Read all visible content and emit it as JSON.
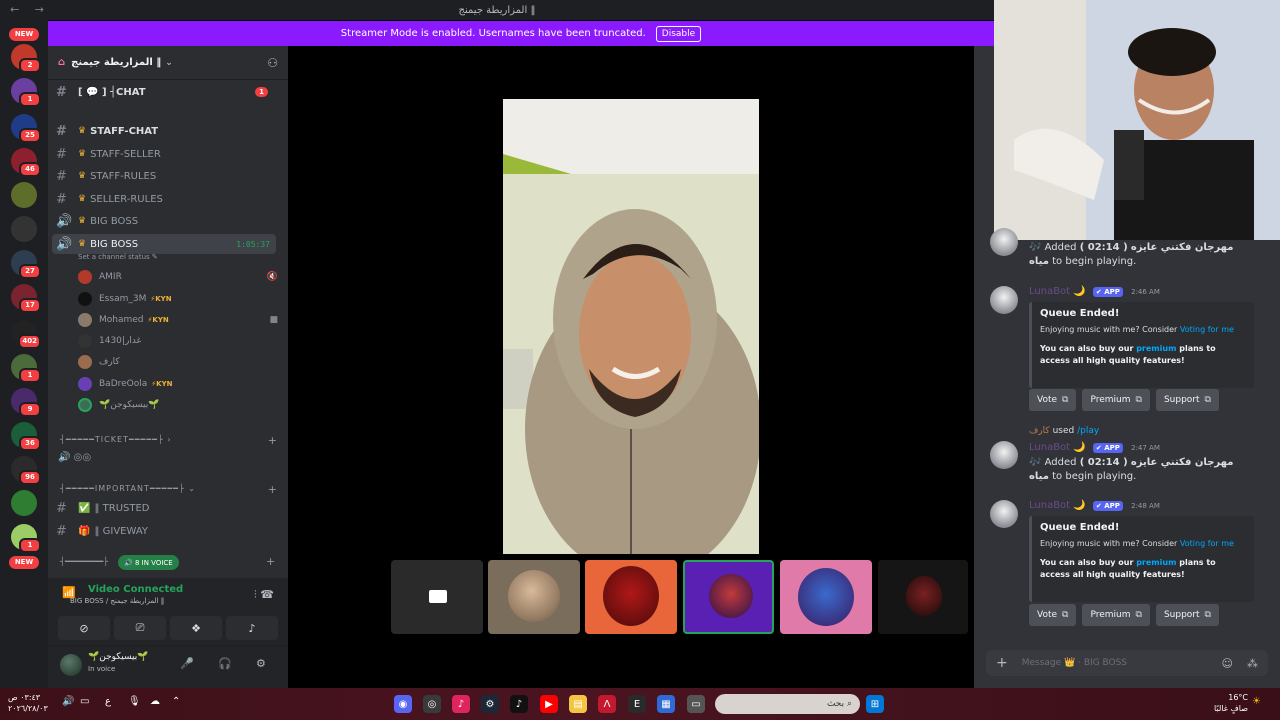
{
  "window": {
    "title": "المزاريطة جيمنج ‖"
  },
  "banner": {
    "text": "Streamer Mode is enabled. Usernames have been truncated.",
    "disable_label": "Disable"
  },
  "rail": {
    "new_top": "NEW",
    "new_bottom": "NEW",
    "badges": [
      "2",
      "1",
      "25",
      "46",
      "27",
      "17",
      "402",
      "1",
      "9",
      "36",
      "96",
      "1"
    ]
  },
  "server": {
    "name": "المزاريطة جيمنج ‖"
  },
  "channels": [
    {
      "name": "[ 💬 ] ┤CHAT",
      "unread": "1"
    },
    {
      "name": "STAFF-CHAT"
    },
    {
      "name": "STAFF-SELLER"
    },
    {
      "name": "STAFF-RULES"
    },
    {
      "name": "SELLER-RULES"
    },
    {
      "name": "BIG BOSS"
    },
    {
      "name": "BIG BOSS",
      "timer": "1:05:37"
    }
  ],
  "channel_status": "Set a channel status",
  "voice_users": [
    {
      "name": "AMIR",
      "tag": ""
    },
    {
      "name": "Essam_3M",
      "tag": "⚡KYN"
    },
    {
      "name": "Mohamed",
      "tag": "⚡KYN"
    },
    {
      "name": "غدار|1430",
      "tag": ""
    },
    {
      "name": "كارف",
      "tag": ""
    },
    {
      "name": "BaDreOola",
      "tag": "⚡KYN"
    },
    {
      "name": "🌱ﺑﯿﺴﯿﻜﻮﺟﻦ🌱",
      "tag": ""
    }
  ],
  "categories": {
    "ticket": "┤━━━━━TICKET━━━━━├",
    "important": "┤━━━━━IMPORTANT━━━━━├"
  },
  "channels2": [
    {
      "name": "‖ TRUSTED"
    },
    {
      "name": "‖ GIVEWAY"
    }
  ],
  "in_voice_pill": "8 IN VOICE",
  "voice_panel": {
    "title": "Video Connected",
    "subtitle": "BIG BOSS / المزاريطة جيمنج ‖"
  },
  "user_panel": {
    "name": "🌱ﺑﯿﺴﯿﻜﻮﺟﻦ🌱",
    "status": "In voice"
  },
  "chat": {
    "msg1": {
      "added_prefix": "Added",
      "duration": "( 02:14 )",
      "song": "مهرجان فكتني عايزه مياه",
      "suffix": "to begin playing."
    },
    "bot_name": "LunaBot",
    "app_tag": "APP",
    "embed1": {
      "time": "2:46 AM",
      "title": "Queue Ended!",
      "desc_prefix": "Enjoying music with me? Consider",
      "desc_link": "Voting for me",
      "buy_prefix": "You can also buy our",
      "buy_link": "premium",
      "buy_suffix": "plans to access all high quality features!"
    },
    "buttons": [
      "Vote",
      "Premium",
      "Support"
    ],
    "used": {
      "user": "كارف",
      "text": "used",
      "command": "play"
    },
    "msg2": {
      "time": "2:47 AM"
    },
    "embed2": {
      "time": "2:48 AM"
    },
    "composer_placeholder": "Message 👑 · BIG BOSS"
  },
  "taskbar": {
    "time": "٠٣:٤٣ ص",
    "date": "٢٠٢٦/٢٨/٠٣",
    "search": "بحث",
    "temp": "16°C",
    "weather": "صافٍ غالبًا",
    "lang": "ع"
  }
}
